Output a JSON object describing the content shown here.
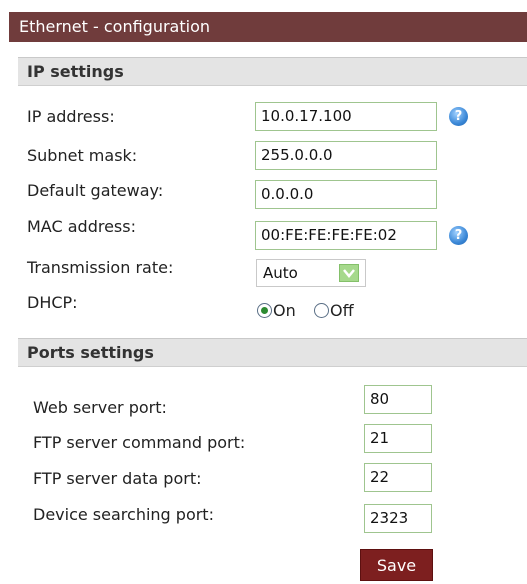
{
  "title": "Ethernet - configuration",
  "ip_settings": {
    "heading": "IP settings",
    "ip_address": {
      "label": "IP address:",
      "value": "10.0.17.100"
    },
    "subnet_mask": {
      "label": "Subnet mask:",
      "value": "255.0.0.0"
    },
    "default_gateway": {
      "label": "Default gateway:",
      "value": "0.0.0.0"
    },
    "mac_address": {
      "label": "MAC address:",
      "value": "00:FE:FE:FE:FE:02"
    },
    "transmission_rate": {
      "label": "Transmission rate:",
      "selected": "Auto"
    },
    "dhcp": {
      "label": "DHCP:",
      "options": [
        "On",
        "Off"
      ],
      "selected": "On"
    }
  },
  "ports_settings": {
    "heading": "Ports settings",
    "web_server_port": {
      "label": "Web server port:",
      "value": "80"
    },
    "ftp_command_port": {
      "label": "FTP server command port:",
      "value": "21"
    },
    "ftp_data_port": {
      "label": "FTP server data port:",
      "value": "22"
    },
    "device_search_port": {
      "label": "Device searching port:",
      "value": "2323"
    }
  },
  "save_label": "Save",
  "colors": {
    "title_bar": "#703c3c",
    "section_bar": "#e4e4e4",
    "field_border": "#9fc58f",
    "save_button": "#7d1f1f",
    "help_icon": "#3a87d6"
  }
}
